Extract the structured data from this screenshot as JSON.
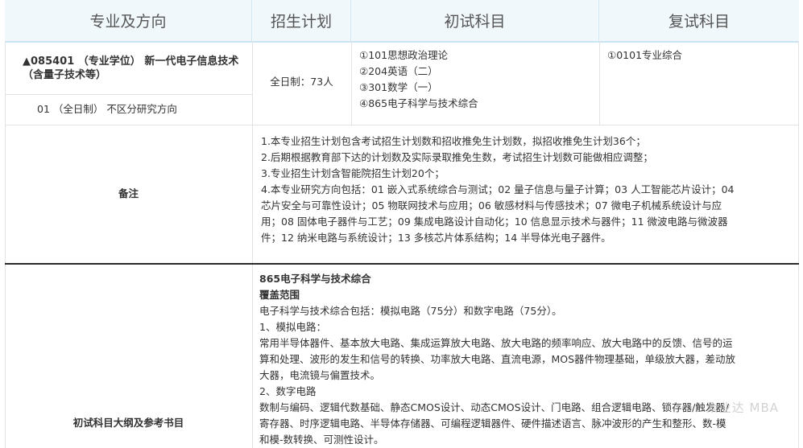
{
  "header": {
    "col1": "专业及方向",
    "col2": "招生计划",
    "col3": "初试科目",
    "col4": "复试科目"
  },
  "program": {
    "title_line1": "▲085401 （专业学位） 新一代电子信息技术",
    "title_line2": "（含量子技术等）",
    "direction": "01 （全日制） 不区分研究方向",
    "plan": "全日制：73人",
    "exam_subjects": [
      "①101思想政治理论",
      "②204英语（二）",
      "③301数学（一）",
      "④865电子科学与技术综合"
    ],
    "retest": "①0101专业综合"
  },
  "notes": {
    "label": "备注",
    "lines": [
      "1.本专业招生计划包含考试招生计划数和招收推免生计划数，拟招收推免生计划36个；",
      "2.后期根据教育部下达的计划数及实际录取推免生数，考试招生计划数可能做相应调整；",
      "3.专业招生计划含智能院招生计划20个；",
      "4.本专业研究方向包括：01 嵌入式系统综合与测试；02 量子信息与量子计算；03 人工智能芯片设计；04",
      "芯片安全与可靠性设计；05 物联网技术与应用；06 敏感材料与传感技术；07 微电子机械系统设计与应",
      "用；08 固体电子器件与工艺；09 集成电路设计自动化；10 信息显示技术与器件；11 微波电路与微波器",
      "件；12 纳米电路与系统设计；13 多核芯片体系结构；14 半导体光电子器件。"
    ]
  },
  "syllabus": {
    "label": "初试科目大纲及参考书目",
    "course_title": "865电子科学与技术综合",
    "coverage_title": "覆盖范围",
    "lines": [
      "电子科学与技术综合包括：模拟电路（75分）和数字电路（75分）。",
      "1、模拟电路：",
      "常用半导体器件、基本放大电路、集成运算放大电路、放大电路的频率响应、放大电路中的反馈、信号的运",
      "算和处理、波形的发生和信号的转换、功率放大电路、直流电源，MOS器件物理基础，单级放大器，差动放",
      "大器，电流镜与偏置技术。",
      "2、数字电路",
      "数制与编码、逻辑代数基础、静态CMOS设计、动态CMOS设计、门电路、组合逻辑电路、锁存器/触发器/",
      "寄存器、时序逻辑电路、半导体存储器、可编程逻辑器件、硬件描述语言、脉冲波形的产生和整形、数-模",
      "和模-数转换、可测性设计。"
    ]
  },
  "watermark": "众业达 MBA"
}
